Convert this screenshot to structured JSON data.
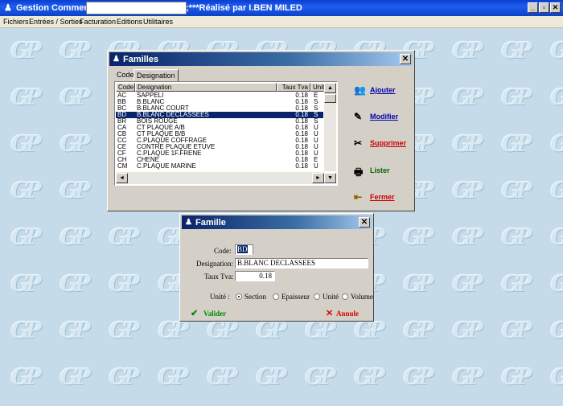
{
  "app": {
    "title": "Gestion Commerciale",
    "credit": ";***Réalisé par I.BEN MILED",
    "window_controls": {
      "minimize": "_",
      "maximize": "▫",
      "close": "✕"
    }
  },
  "menu": [
    "Fichiers",
    "Entrées / Sorties",
    "Facturation",
    "Editions",
    "Utilitaires"
  ],
  "desktop": {
    "tile_text": "GP"
  },
  "familles": {
    "title": "Familles",
    "close": "✕",
    "tabs": [
      "Code",
      "Designation"
    ],
    "columns": [
      "Code",
      "Designation",
      "Taux Tva",
      "Unite"
    ],
    "rows": [
      {
        "code": "AC",
        "designation": "SAPPELI",
        "tva": "0.18",
        "unite": "E"
      },
      {
        "code": "BB",
        "designation": "B.BLANC",
        "tva": "0.18",
        "unite": "S"
      },
      {
        "code": "BC",
        "designation": "B.BLANC COURT",
        "tva": "0.18",
        "unite": "S"
      },
      {
        "code": "BD",
        "designation": "B.BLANC DECLASSEES",
        "tva": "0.18",
        "unite": "S",
        "selected": true
      },
      {
        "code": "BR",
        "designation": "BOIS ROUGE",
        "tva": "0.18",
        "unite": "S"
      },
      {
        "code": "CA",
        "designation": "CT PLAQUE A/B",
        "tva": "0.18",
        "unite": "U"
      },
      {
        "code": "CB",
        "designation": "CT PLAQUE B/B",
        "tva": "0.18",
        "unite": "U"
      },
      {
        "code": "CC",
        "designation": "C.PLAQUE COFFRAGE",
        "tva": "0.18",
        "unite": "U"
      },
      {
        "code": "CE",
        "designation": "CONTRE PLAQUE ETUVE",
        "tva": "0.18",
        "unite": "U"
      },
      {
        "code": "CF",
        "designation": "C.PLAQUE 1F.FRENE",
        "tva": "0.18",
        "unite": "U"
      },
      {
        "code": "CH",
        "designation": "CHENE",
        "tva": "0.18",
        "unite": "E"
      },
      {
        "code": "CM",
        "designation": "C.PLAQUE MARINE",
        "tva": "0.18",
        "unite": "U"
      }
    ],
    "scroll_glyphs": {
      "up": "▲",
      "down": "▼",
      "left": "◄",
      "right": "►"
    },
    "actions": [
      {
        "label": "Ajouter",
        "icon": "👥",
        "color": "#0000aa"
      },
      {
        "label": "Modifier",
        "icon": "✎",
        "color": "#0000aa"
      },
      {
        "label": "Supprimer",
        "icon": "✂",
        "color": "#cc0000"
      },
      {
        "label": "Lister",
        "icon": "🖶",
        "color": "#006600"
      },
      {
        "label": "Fermer",
        "icon": "⇤",
        "color": "#cc0000"
      }
    ]
  },
  "famille": {
    "title": "Famille",
    "close": "✕",
    "code_label": "Code:",
    "code_value": "BD",
    "designation_label": "Designation:",
    "designation_value": "B.BLANC DECLASSEES",
    "tva_label": "Taux Tva:",
    "tva_value": "0.18",
    "unite_label": "Unité :",
    "unite_options": [
      "Section",
      "Epaisseur",
      "Unité",
      "Volume"
    ],
    "unite_selected": "Section",
    "valider_icon": "✔",
    "valider_label": "Valider",
    "annule_icon": "✕",
    "annule_label": "Annule"
  }
}
